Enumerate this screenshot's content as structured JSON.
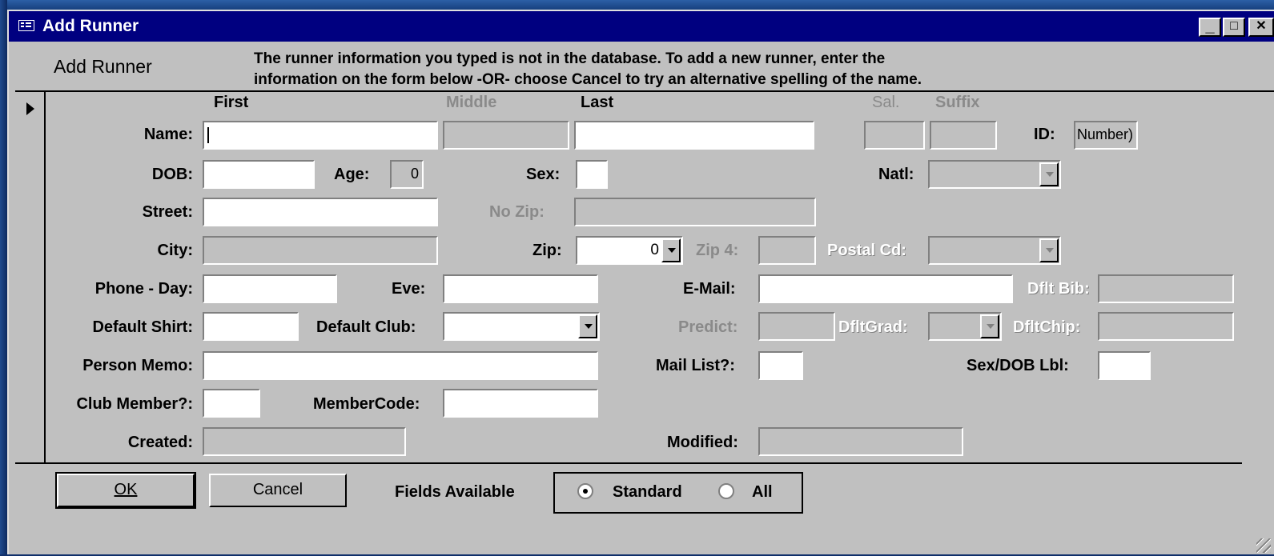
{
  "window": {
    "title": "Add Runner",
    "buttons": {
      "minimize": "_",
      "maximize": "□",
      "close": "✕"
    }
  },
  "header": {
    "form_title": "Add Runner",
    "message_line1": "The runner information you typed is not in the database. To add a new runner, enter the",
    "message_line2": "information on the form below -OR- choose Cancel to try an alternative spelling of the name."
  },
  "columns": {
    "first": "First",
    "middle": "Middle",
    "last": "Last",
    "sal": "Sal.",
    "suffix": "Suffix"
  },
  "labels": {
    "name": "Name:",
    "id": "ID:",
    "dob": "DOB:",
    "age": "Age:",
    "sex": "Sex:",
    "natl": "Natl:",
    "street": "Street:",
    "nozip": "No Zip:",
    "city": "City:",
    "zip": "Zip:",
    "zip4": "Zip 4:",
    "postal": "Postal Cd:",
    "phone_day": "Phone - Day:",
    "eve": "Eve:",
    "email": "E-Mail:",
    "dflt_bib": "Dflt Bib:",
    "default_shirt": "Default Shirt:",
    "default_club": "Default Club:",
    "predict": "Predict:",
    "dflt_grad": "DfltGrad:",
    "dflt_chip": "DfltChip:",
    "person_memo": "Person Memo:",
    "mail_list": "Mail List?:",
    "sex_dob_lbl": "Sex/DOB Lbl:",
    "club_member": "Club Member?:",
    "member_code": "MemberCode:",
    "created": "Created:",
    "modified": "Modified:"
  },
  "values": {
    "id": "Number)",
    "age": "0",
    "zip": "0"
  },
  "footer": {
    "ok": "OK",
    "cancel": "Cancel",
    "fields_available": "Fields Available",
    "standard": "Standard",
    "all": "All",
    "selected": "Standard"
  }
}
